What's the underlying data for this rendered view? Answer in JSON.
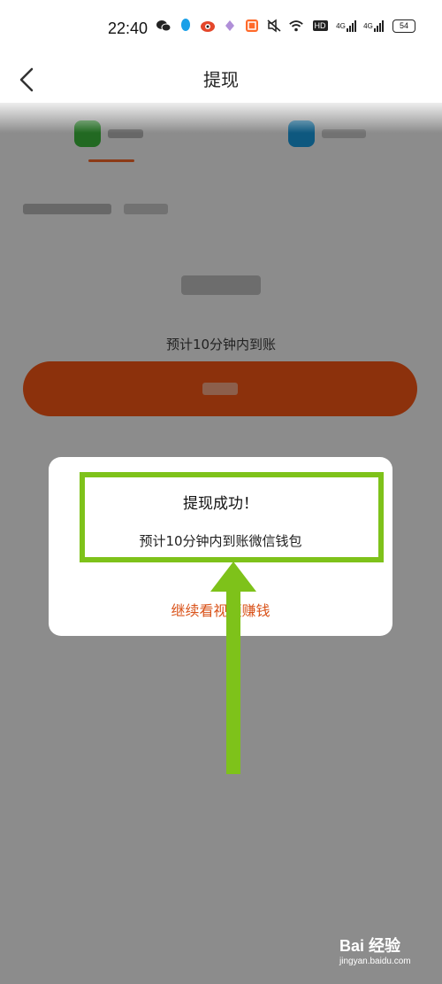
{
  "status_bar": {
    "time": "22:40",
    "icons": [
      "wechat-icon",
      "qq-icon",
      "weibo-icon",
      "app-icon",
      "app-icon-2",
      "mute-icon",
      "wifi-icon",
      "hd-icon",
      "signal-4g-icon",
      "signal-4g-icon-2",
      "battery-icon"
    ],
    "hd_label": "HD",
    "network_label": "4G",
    "network_label_2": "4G",
    "battery_level": "54"
  },
  "nav": {
    "title": "提现",
    "back_icon": "chevron-left-icon"
  },
  "dialog": {
    "title": "提现成功！",
    "message": "预计10分钟内到账微信钱包",
    "action": "继续看视频赚钱"
  },
  "page": {
    "eta_note": "预计10分钟内到账"
  },
  "watermark": {
    "brand": "Bai 经验",
    "url": "jingyan.baidu.com"
  },
  "colors": {
    "accent": "#ff5a16",
    "highlight": "#7ec21a",
    "action_text": "#d9531a"
  }
}
